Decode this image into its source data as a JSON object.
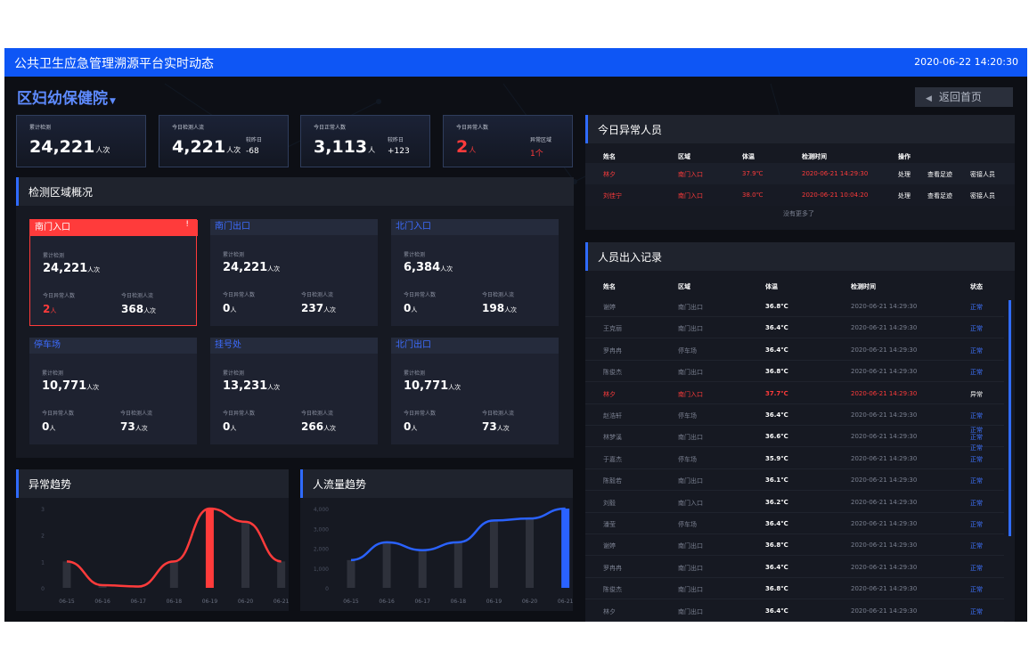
{
  "header": {
    "title": "公共卫生应急管理溯源平台实时动态",
    "datetime": "2020-06-22 14:20:30"
  },
  "hospital": {
    "name": "区妇幼保健院",
    "back_label": "返回首页"
  },
  "summary": [
    {
      "label": "累计检测",
      "value": "24,221",
      "unit": "人次",
      "sub_label": "",
      "sub_value": ""
    },
    {
      "label": "今日检测人流",
      "value": "4,221",
      "unit": "人次",
      "sub_label": "较昨日",
      "sub_value": "-68"
    },
    {
      "label": "今日正常人数",
      "value": "3,113",
      "unit": "人",
      "sub_label": "较昨日",
      "sub_value": "+123"
    },
    {
      "label": "今日异常人数",
      "value": "2",
      "unit": "人",
      "sub_label": "异常区域",
      "sub_value": "1个"
    }
  ],
  "zones_panel": {
    "title": "检测区域概况",
    "labels": {
      "total": "累计检测",
      "abnormal": "今日异常人数",
      "checked": "今日检测人流"
    },
    "zones": [
      {
        "name": "南门入口",
        "total": "24,221",
        "abnormal": "2",
        "checked": "368",
        "alert": true,
        "alert_mark": "!"
      },
      {
        "name": "南门出口",
        "total": "24,221",
        "abnormal": "0",
        "checked": "237"
      },
      {
        "name": "北门入口",
        "total": "6,384",
        "abnormal": "0",
        "checked": "198"
      },
      {
        "name": "停车场",
        "total": "10,771",
        "abnormal": "0",
        "checked": "73"
      },
      {
        "name": "挂号处",
        "total": "13,231",
        "abnormal": "0",
        "checked": "266"
      },
      {
        "name": "北门出口",
        "total": "10,771",
        "abnormal": "0",
        "checked": "73"
      }
    ],
    "unit_person": "人",
    "unit_times": "人次"
  },
  "abnormal_panel": {
    "title": "今日异常人员",
    "columns": [
      "姓名",
      "区域",
      "体温",
      "检测时间",
      "操作"
    ],
    "rows": [
      {
        "name": "林夕",
        "zone": "南门入口",
        "temp": "37.9℃",
        "time": "2020-06-21 14:29:30"
      },
      {
        "name": "刘佳宁",
        "zone": "南门入口",
        "temp": "38.0℃",
        "time": "2020-06-21 10:04:20"
      }
    ],
    "actions": [
      "处理",
      "查看足迹",
      "密接人员"
    ],
    "no_more": "没有更多了"
  },
  "access_panel": {
    "title": "人员出入记录",
    "columns": [
      "姓名",
      "区域",
      "体温",
      "检测时间",
      "状态"
    ],
    "rows": [
      {
        "name": "谢婷",
        "zone": "南门出口",
        "temp": "36.8℃",
        "time": "2020-06-21 14:29:30",
        "status": "正常"
      },
      {
        "name": "王克丽",
        "zone": "南门出口",
        "temp": "36.4℃",
        "time": "2020-06-21 14:29:30",
        "status": "正常"
      },
      {
        "name": "罗冉冉",
        "zone": "停车场",
        "temp": "36.4℃",
        "time": "2020-06-21 14:29:30",
        "status": "正常"
      },
      {
        "name": "陈俊杰",
        "zone": "南门出口",
        "temp": "36.8℃",
        "time": "2020-06-21 14:29:30",
        "status": "正常"
      },
      {
        "name": "林夕",
        "zone": "南门入口",
        "temp": "37.7℃",
        "time": "2020-06-21 14:29:30",
        "status": "异常",
        "abnormal": true
      },
      {
        "name": "赵浩轩",
        "zone": "停车场",
        "temp": "36.4℃",
        "time": "2020-06-21 14:29:30",
        "status": "正常"
      },
      {
        "name": "林梦溪",
        "zone": "南门出口",
        "temp": "36.6℃",
        "time": "2020-06-21 14:29:30",
        "status": "正常"
      },
      {
        "name": "于嘉杰",
        "zone": "停车场",
        "temp": "35.9℃",
        "time": "2020-06-21 14:29:30",
        "status": "正常"
      },
      {
        "name": "陈毅若",
        "zone": "南门出口",
        "temp": "36.1℃",
        "time": "2020-06-21 14:29:30",
        "status": "正常"
      },
      {
        "name": "刘毅",
        "zone": "南门入口",
        "temp": "36.2℃",
        "time": "2020-06-21 14:29:30",
        "status": "正常"
      },
      {
        "name": "潘莹",
        "zone": "停车场",
        "temp": "36.4℃",
        "time": "2020-06-21 14:29:30",
        "status": "正常"
      },
      {
        "name": "谢婷",
        "zone": "南门出口",
        "temp": "36.8℃",
        "time": "2020-06-21 14:29:30",
        "status": "正常"
      },
      {
        "name": "罗冉冉",
        "zone": "南门出口",
        "temp": "36.4℃",
        "time": "2020-06-21 14:29:30",
        "status": "正常"
      },
      {
        "name": "陈俊杰",
        "zone": "南门出口",
        "temp": "36.8℃",
        "time": "2020-06-21 14:29:30",
        "status": "正常"
      },
      {
        "name": "林夕",
        "zone": "南门出口",
        "temp": "36.4℃",
        "time": "2020-06-21 14:29:30",
        "status": "正常"
      }
    ],
    "extra_status": [
      "正常",
      "正常"
    ]
  },
  "charts": {
    "abnormal_title": "异常趋势",
    "flow_title": "人流量趋势"
  },
  "colors": {
    "accent": "#2f6bff",
    "topbar": "#0e56f5",
    "alert": "#ff3b3b",
    "bg": "#0d0f15"
  },
  "chart_data": [
    {
      "type": "bar",
      "title": "异常趋势",
      "categories": [
        "06-15",
        "06-16",
        "06-17",
        "06-18",
        "06-19",
        "06-20",
        "06-21"
      ],
      "values": [
        1,
        0.1,
        0.05,
        1,
        3,
        2.5,
        1
      ],
      "highlight_index": 4,
      "highlight_color": "#ff3b3b",
      "line_color": "#ff3b3b",
      "yticks": [
        "0",
        "1",
        "2",
        "3"
      ],
      "ylim": [
        0,
        3
      ]
    },
    {
      "type": "bar",
      "title": "人流量趋势",
      "categories": [
        "06-15",
        "06-16",
        "06-17",
        "06-18",
        "06-19",
        "06-20",
        "06-21"
      ],
      "values": [
        1400,
        2300,
        1900,
        2300,
        3400,
        3500,
        4000
      ],
      "highlight_index": 6,
      "highlight_color": "#2a62ff",
      "line_color": "#2a62ff",
      "yticks": [
        "0",
        "1,000",
        "2,000",
        "3,000",
        "4,000"
      ],
      "ylim": [
        0,
        4000
      ]
    }
  ]
}
